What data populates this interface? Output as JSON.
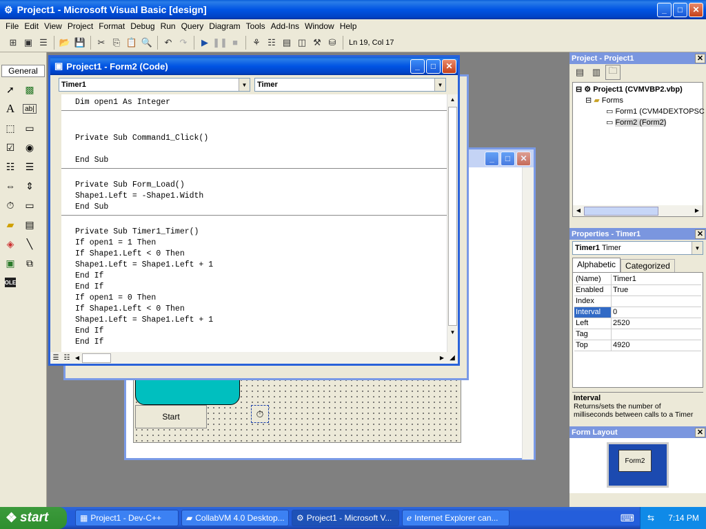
{
  "app": {
    "title": "Project1 - Microsoft Visual Basic [design]",
    "window_buttons": {
      "minimize": "_",
      "maximize": "□",
      "close": "✕"
    }
  },
  "menu": [
    "File",
    "Edit",
    "View",
    "Project",
    "Format",
    "Debug",
    "Run",
    "Query",
    "Diagram",
    "Tools",
    "Add-Ins",
    "Window",
    "Help"
  ],
  "toolbar": {
    "position": "Ln 19, Col 17"
  },
  "toolbox": {
    "header": "General"
  },
  "code_window": {
    "title": "Project1 - Form2 (Code)",
    "object_combo": "Timer1",
    "procedure_combo": "Timer",
    "lines": [
      "Dim open1 As Integer",
      "",
      "",
      "Private Sub Command1_Click()",
      "",
      "End Sub",
      "",
      "Private Sub Form_Load()",
      "Shape1.Left = -Shape1.Width",
      "End Sub",
      "",
      "Private Sub Timer1_Timer()",
      "If open1 = 1 Then",
      "If Shape1.Left < 0 Then",
      "Shape1.Left = Shape1.Left + 1",
      "End If",
      "End If",
      "If open1 = 0 Then",
      "If Shape1.Left < 0 Then",
      "Shape1.Left = Shape1.Left + 1",
      "End If",
      "End If"
    ]
  },
  "form_designer": {
    "start_button": "Start"
  },
  "project_panel": {
    "title": "Project - Project1",
    "root": "Project1 (CVMVBP2.vbp)",
    "folder": "Forms",
    "items": [
      "Form1 (CVM4DEXTOPSC",
      "Form2 (Form2)"
    ]
  },
  "properties_panel": {
    "title": "Properties - Timer1",
    "object": "Timer1",
    "object_type": "Timer",
    "tabs": [
      "Alphabetic",
      "Categorized"
    ],
    "rows": [
      {
        "name": "(Name)",
        "value": "Timer1"
      },
      {
        "name": "Enabled",
        "value": "True"
      },
      {
        "name": "Index",
        "value": ""
      },
      {
        "name": "Interval",
        "value": "0"
      },
      {
        "name": "Left",
        "value": "2520"
      },
      {
        "name": "Tag",
        "value": ""
      },
      {
        "name": "Top",
        "value": "4920"
      }
    ],
    "desc_title": "Interval",
    "desc_text": "Returns/sets the number of milliseconds between calls to a Timer"
  },
  "form_layout": {
    "title": "Form Layout",
    "label": "Form2"
  },
  "taskbar": {
    "start": "start",
    "tasks": [
      "Project1 - Dev-C++",
      "CollabVM 4.0 Desktop...",
      "Project1 - Microsoft V...",
      "Internet Explorer can..."
    ],
    "clock": "7:14 PM"
  },
  "colors": {
    "xp_blue": "#0054e3",
    "teal_shape": "#00bfbf",
    "selection": "#316ac5",
    "start_green": "#2f8f2f"
  }
}
